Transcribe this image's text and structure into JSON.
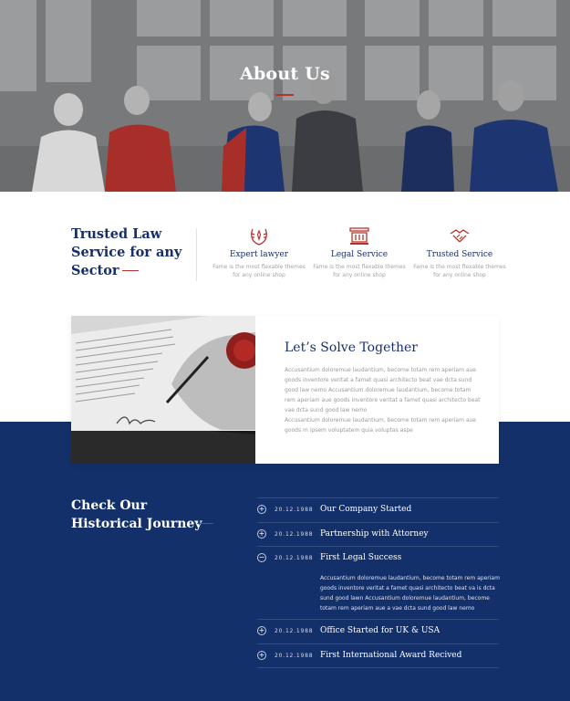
{
  "hero": {
    "title": "About Us"
  },
  "trusted": {
    "title": "Trusted Law Service for any Sector",
    "features": [
      {
        "icon": "laurel-icon",
        "title": "Expert lawyer",
        "desc": "Fame is the most flexable themes for any online shop"
      },
      {
        "icon": "pillar-icon",
        "title": "Legal Service",
        "desc": "Fame is the most flexable themes for any online shop"
      },
      {
        "icon": "handshake-icon",
        "title": "Trusted Service",
        "desc": "Fame is the most flexable themes for any online shop"
      }
    ]
  },
  "solve": {
    "title": "Let’s Solve Together",
    "p1": "Accusantium doloremue laudantium, become totam rem aperiam aue goods inventore veritat a famet quasi architecto beat vae dcta sund good law nemo Accusantium doloremue laudantium, become totam rem aperiam aue goods inventore veritat a famet quasi architecto beat vae dcta sund good law nemo",
    "p2": "Accusantium doloremue laudantium, become totam rem aperiam aue goods m ipsem voluptatem quia voluptas aspe"
  },
  "journey": {
    "title": "Check Our Historical Journey",
    "items": [
      {
        "toggle": "+",
        "date": "20.12.1988",
        "label": "Our Company Started"
      },
      {
        "toggle": "+",
        "date": "20.12.1988",
        "label": "Partnership with Attorney"
      },
      {
        "toggle": "−",
        "date": "20.12.1988",
        "label": "First Legal Success",
        "body": "Accusantium doloremue laudantium, become totam rem aperiam goods inventore veritat a famet quasi architecto beat va is dcta sund good lawn Accusantium doloremue laudantium, become totam rem aperiam aue a vae dcta sund good law nemo"
      },
      {
        "toggle": "+",
        "date": "20.12.1988",
        "label": "Office Started for UK & USA"
      },
      {
        "toggle": "+",
        "date": "20.12.1988",
        "label": "First International Award Recived"
      }
    ]
  },
  "colors": {
    "navy": "#13306a",
    "accent": "#b8322c",
    "title_navy": "#172e6b"
  }
}
